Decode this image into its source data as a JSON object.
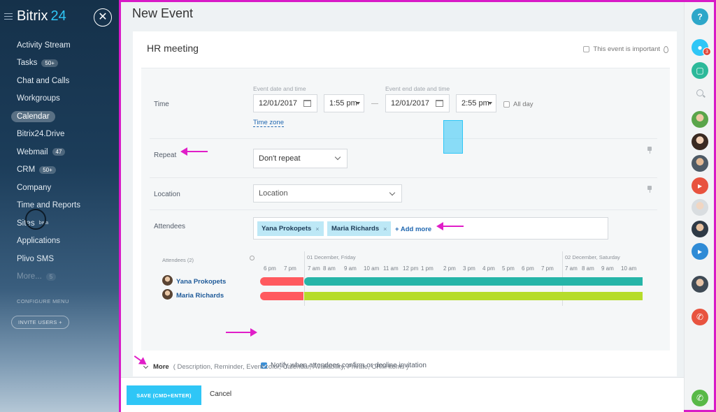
{
  "sidebar": {
    "logo_main": "Bitrix",
    "logo_num": "24",
    "close_symbol": "✕",
    "items": [
      {
        "label": "Activity Stream",
        "counter": ""
      },
      {
        "label": "Tasks",
        "counter": "50+"
      },
      {
        "label": "Chat and Calls",
        "counter": ""
      },
      {
        "label": "Workgroups",
        "counter": ""
      },
      {
        "label": "Calendar",
        "counter": ""
      },
      {
        "label": "Bitrix24.Drive",
        "counter": ""
      },
      {
        "label": "Webmail",
        "counter": "47"
      },
      {
        "label": "CRM",
        "counter": "50+"
      },
      {
        "label": "Company",
        "counter": ""
      },
      {
        "label": "Time and Reports",
        "counter": ""
      },
      {
        "label": "Sites",
        "counter": "beta"
      },
      {
        "label": "Applications",
        "counter": ""
      },
      {
        "label": "Plivo SMS",
        "counter": ""
      },
      {
        "label": "More...",
        "counter": "5"
      }
    ],
    "configure_label": "CONFIGURE MENU",
    "invite_label": "INVITE USERS  +"
  },
  "page": {
    "title": "New Event",
    "event_name": "HR meeting",
    "important_label": "This event is important"
  },
  "time": {
    "label": "Time",
    "start_caption": "Event date and time",
    "end_caption": "Event end date and time",
    "start_date": "12/01/2017",
    "start_time": "1:55 pm",
    "end_date": "12/01/2017",
    "end_time": "2:55 pm",
    "dash": "—",
    "all_day": "All day",
    "timezone_link": "Time zone"
  },
  "repeat": {
    "label": "Repeat",
    "value": "Don't repeat"
  },
  "location": {
    "label": "Location",
    "placeholder": "Location"
  },
  "attendees": {
    "label": "Attendees",
    "tags": [
      "Yana Prokopets",
      "Maria Richards"
    ],
    "tag_remove": "×",
    "add_more": "+ Add more"
  },
  "planner": {
    "header": "Attendees (2)",
    "day1": "01 December, Friday",
    "day2": "02 December, Saturday",
    "hours": [
      "6 pm",
      "7 pm",
      "7 am",
      "8 am",
      "9 am",
      "10 am",
      "11 am",
      "12 pm",
      "1 pm",
      "2 pm",
      "3 pm",
      "4 pm",
      "5 pm",
      "6 pm",
      "7 pm",
      "7 am",
      "8 am",
      "9 am",
      "10 am"
    ],
    "people": [
      {
        "name": "Yana Prokopets",
        "color": "#26b5a8"
      },
      {
        "name": "Maria Richards",
        "color": "#b6dc2b"
      }
    ],
    "busy_color": "#ff5a5f"
  },
  "notify_label": "Notify when attendees confirm or decline invitation",
  "more": {
    "label": "More",
    "details": "( Description,  Reminder,  Event color,  Calendar,  Availability,  Private,  CRM items )"
  },
  "footer": {
    "save_label": "SAVE (CMD+ENTER)",
    "cancel_label": "Cancel"
  },
  "rail": {
    "help_symbol": "?",
    "notifications_count": "3"
  },
  "colors": {
    "accent": "#2fc6f6",
    "annotation": "#d81ac7",
    "link": "#2067b0"
  }
}
